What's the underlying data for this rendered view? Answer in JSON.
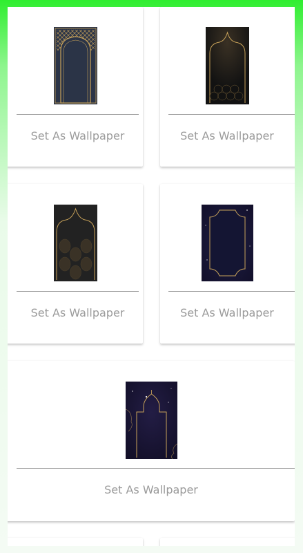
{
  "wallpapers": [
    {
      "id": "gold-lattice-arch",
      "button_label": "Set As Wallpaper"
    },
    {
      "id": "dark-gold-dome-arch",
      "button_label": "Set As Wallpaper"
    },
    {
      "id": "gold-arch-pattern",
      "button_label": "Set As Wallpaper"
    },
    {
      "id": "navy-ornate-frame",
      "button_label": "Set As Wallpaper"
    },
    {
      "id": "starry-mosque-frame",
      "button_label": "Set As Wallpaper"
    }
  ],
  "colors": {
    "background_top": "#2fee2f",
    "card_background": "#ffffff",
    "button_text": "#9b9b9b",
    "divider": "#9a9a9a",
    "gold_accent": "#c9a35a"
  }
}
